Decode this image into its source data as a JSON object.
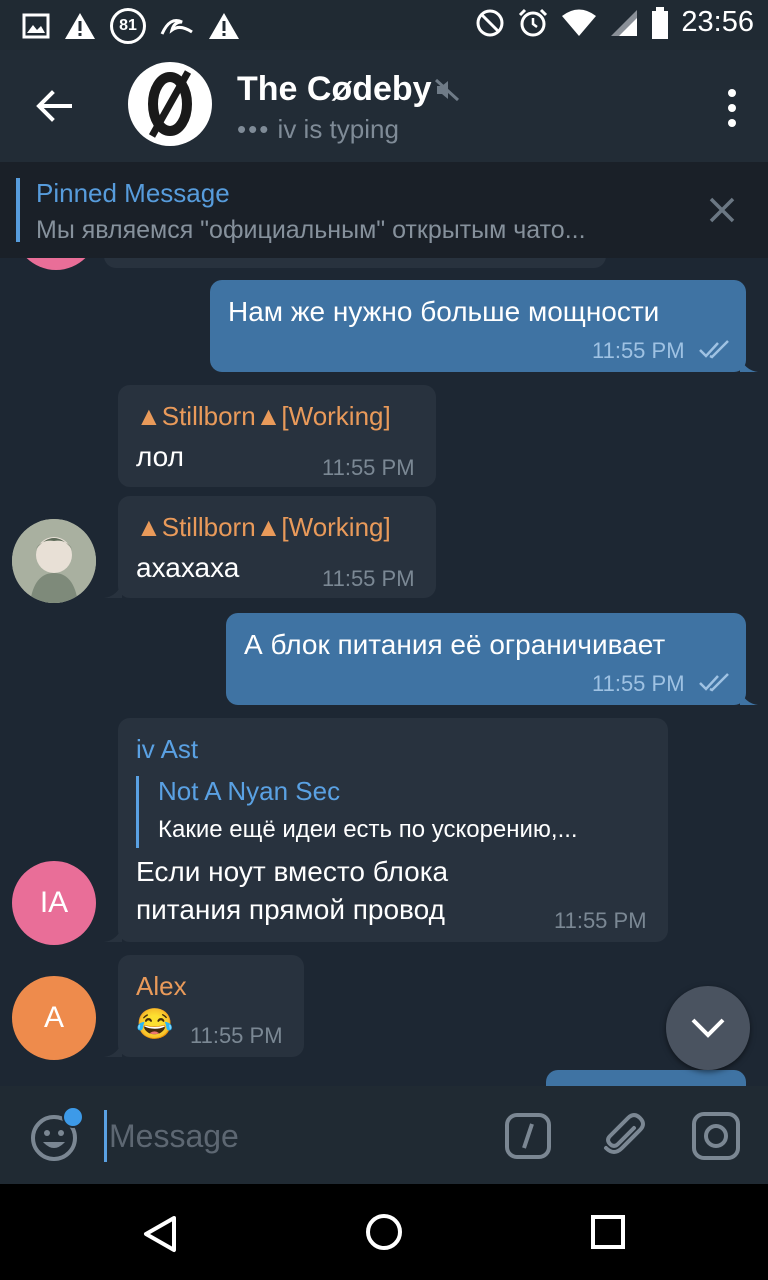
{
  "status_bar": {
    "time": "23:56",
    "badge": "81",
    "icons": [
      "image-icon",
      "warning-icon",
      "badge-81-icon",
      "surf-icon",
      "warning-icon",
      "do-not-disturb-icon",
      "alarm-icon",
      "wifi-icon",
      "signal-icon",
      "battery-icon"
    ]
  },
  "header": {
    "title": "The Cødeby",
    "status": "iv is typing",
    "accent_color": "#5aa1e3"
  },
  "pinned": {
    "title": "Pinned Message",
    "text": "Мы являемся \"официальным\" открытым чато..."
  },
  "messages": [
    {
      "direction": "out",
      "text": "Нам же нужно больше мощности",
      "time": "11:55 PM",
      "read": true
    },
    {
      "direction": "in",
      "sender": "▲Stillborn▲[Working]",
      "text": "лол",
      "time": "11:55 PM"
    },
    {
      "direction": "in",
      "sender": "▲Stillborn▲[Working]",
      "text": "ахахаха",
      "time": "11:55 PM"
    },
    {
      "direction": "out",
      "text": "А блок питания её ограничивает",
      "time": "11:55 PM",
      "read": true
    },
    {
      "direction": "in",
      "sender": "iv Ast",
      "reply_to": {
        "sender": "Not A Nyan Sec",
        "text": "Какие ещё идеи есть по ускорению,..."
      },
      "text_lines": [
        "Если ноут вместо блока",
        "питания прямой провод"
      ],
      "time": "11:55 PM"
    },
    {
      "direction": "in",
      "sender": "Alex",
      "text": "😂",
      "time": "11:55 PM"
    }
  ],
  "avatars": {
    "iv_ast": "IA",
    "alex": "A"
  },
  "colors": {
    "sender_orange": "#e99a5a",
    "sender_blue": "#5aa1e3",
    "avatar_pink": "#e96e98",
    "avatar_orange": "#ee8b4c"
  },
  "composer": {
    "placeholder": "Message"
  }
}
